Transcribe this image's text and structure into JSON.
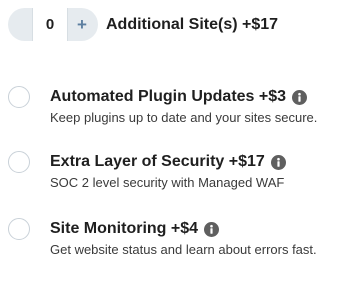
{
  "stepper": {
    "value": "0",
    "minus_label": "−",
    "plus_label": "+",
    "label": "Additional Site(s) +$17"
  },
  "options": [
    {
      "title": "Automated Plugin Updates +$3",
      "description": "Keep plugins up to date and your sites secure.",
      "selected": false
    },
    {
      "title": "Extra Layer of Security +$17",
      "description": "SOC 2 level security with Managed WAF",
      "selected": false
    },
    {
      "title": "Site Monitoring +$4",
      "description": "Get website status and learn about errors fast.",
      "selected": false
    }
  ],
  "colors": {
    "stepper_bg": "#e6ebef",
    "plus_accent": "#5d7fa0",
    "info_icon": "#5f5f5f",
    "radio_border": "#c9d1d8"
  },
  "icons": {
    "info": "info-icon"
  }
}
